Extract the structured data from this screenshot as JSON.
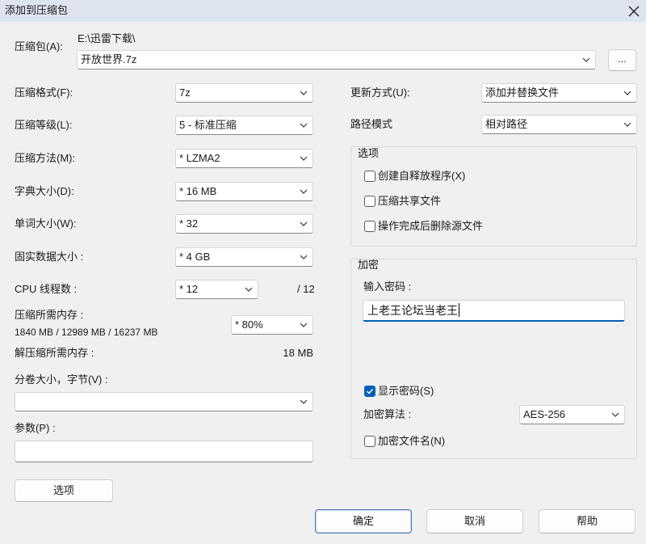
{
  "window": {
    "title": "添加到压缩包"
  },
  "archive": {
    "label": "压缩包(A):",
    "folder": "E:\\迅雷下载\\",
    "name": "开放世界.7z",
    "browse_label": "..."
  },
  "settings": {
    "format": {
      "label": "压缩格式(F):",
      "value": "7z"
    },
    "level": {
      "label": "压缩等级(L):",
      "value": "5 - 标准压缩"
    },
    "method": {
      "label": "压缩方法(M):",
      "value": "* LZMA2"
    },
    "dictionary": {
      "label": "字典大小(D):",
      "value": "* 16 MB"
    },
    "word_size": {
      "label": "单词大小(W):",
      "value": "* 32"
    },
    "solid_block": {
      "label": "固实数据大小 :",
      "value": "* 4 GB"
    },
    "threads": {
      "label": "CPU 线程数 :",
      "value": "* 12",
      "max": "/ 12"
    },
    "memory_compress": {
      "label": "压缩所需内存 :",
      "detail": "1840 MB / 12989 MB / 16237 MB",
      "value": "* 80%"
    },
    "memory_decompress": {
      "label": "解压缩所需内存 :",
      "value": "18 MB"
    },
    "split": {
      "label": "分卷大小，字节(V) :",
      "value": ""
    },
    "parameters": {
      "label": "参数(P) :",
      "value": ""
    },
    "options_button": "选项"
  },
  "update": {
    "label": "更新方式(U):",
    "value": "添加并替换文件"
  },
  "path_mode": {
    "label": "路径模式",
    "value": "相对路径"
  },
  "options_group": {
    "title": "选项",
    "items": [
      {
        "label": "创建自释放程序(X)",
        "checked": false
      },
      {
        "label": "压缩共享文件",
        "checked": false
      },
      {
        "label": "操作完成后删除源文件",
        "checked": false
      }
    ]
  },
  "encryption": {
    "title": "加密",
    "password_label": "输入密码 :",
    "password": "上老王论坛当老王",
    "show_password": {
      "label": "显示密码(S)",
      "checked": true
    },
    "method_label": "加密算法 :",
    "method": "AES-256",
    "encrypt_names": {
      "label": "加密文件名(N)",
      "checked": false
    }
  },
  "buttons": {
    "ok": "确定",
    "cancel": "取消",
    "help": "帮助"
  },
  "colors": {
    "accent": "#005fb8",
    "title_bar": "#dfe4f1",
    "background": "#f0f0f0"
  },
  "icons": {
    "close": "close-icon",
    "dropdown": "chevron-down-icon",
    "check": "checkmark-icon"
  }
}
